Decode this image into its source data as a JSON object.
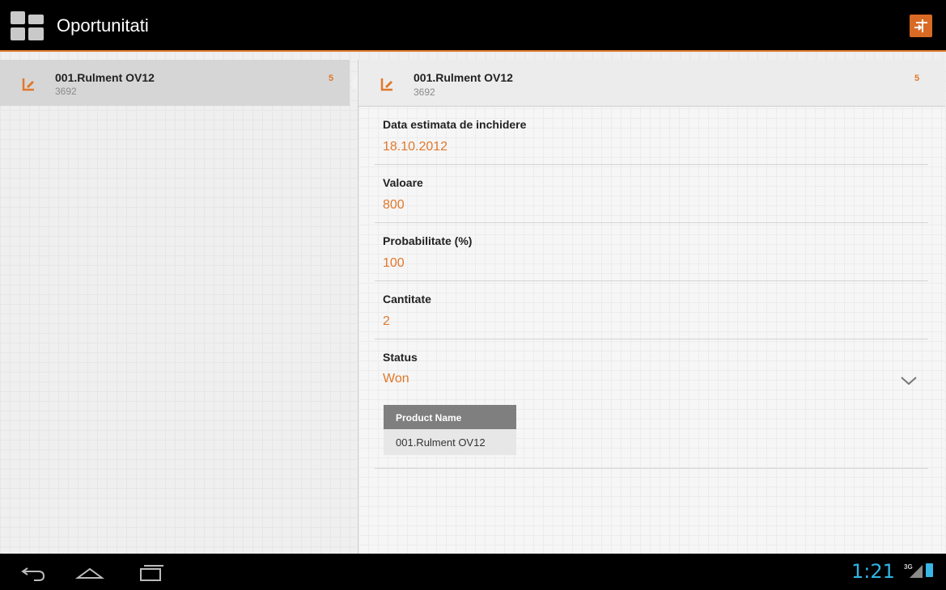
{
  "app": {
    "title": "Oportunitati",
    "accent_color": "#e0782c",
    "logo_icon": "app-grid-icon",
    "action_icon": "filter-settings-icon"
  },
  "list": {
    "items": [
      {
        "title": "001.Rulment OV12",
        "subtitle": "3692",
        "count": "5",
        "icon": "edit-note-icon"
      }
    ]
  },
  "detail": {
    "header": {
      "title": "001.Rulment OV12",
      "subtitle": "3692",
      "count": "5",
      "icon": "edit-note-icon"
    },
    "fields": [
      {
        "label": "Data estimata de inchidere",
        "value": "18.10.2012"
      },
      {
        "label": "Valoare",
        "value": "800"
      },
      {
        "label": "Probabilitate (%)",
        "value": "100"
      },
      {
        "label": "Cantitate",
        "value": "2"
      },
      {
        "label": "Status",
        "value": "Won"
      }
    ],
    "products_table": {
      "header": "Product Name",
      "rows": [
        "001.Rulment OV12"
      ]
    }
  },
  "system_bar": {
    "time": "1:21",
    "network": "3G",
    "clock_color": "#31b5e5",
    "nav_icons": [
      "back-icon",
      "home-icon",
      "recent-apps-icon"
    ]
  }
}
